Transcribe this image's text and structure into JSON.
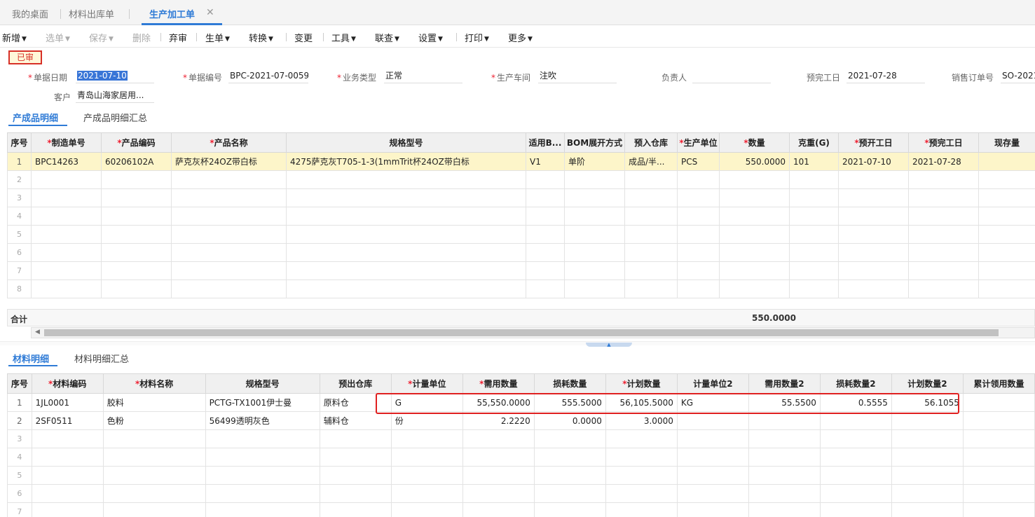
{
  "tabs": [
    {
      "label": "我的桌面"
    },
    {
      "label": "材料出库单"
    },
    {
      "label": "生产加工单"
    }
  ],
  "toolbar": {
    "add": "新增",
    "select": "选单",
    "save": "保存",
    "delete": "删除",
    "unaudit": "弃审",
    "generate": "生单",
    "convert": "转换",
    "change": "变更",
    "tools": "工具",
    "link": "联查",
    "settings": "设置",
    "print": "打印",
    "more": "更多"
  },
  "status": "已审",
  "form": {
    "doc_date": {
      "label": "单据日期",
      "value": "2021-07-10"
    },
    "doc_no": {
      "label": "单据编号",
      "value": "BPC-2021-07-0059"
    },
    "biz_type": {
      "label": "业务类型",
      "value": "正常"
    },
    "workshop": {
      "label": "生产车间",
      "value": "注吹"
    },
    "owner": {
      "label": "负责人",
      "value": ""
    },
    "finish_date": {
      "label": "预完工日",
      "value": "2021-07-28"
    },
    "sales_order": {
      "label": "销售订单号",
      "value": "SO-2021"
    },
    "customer": {
      "label": "客户",
      "value": "青岛山海家居用..."
    }
  },
  "product_tabs": {
    "detail": "产成品明细",
    "summary": "产成品明细汇总"
  },
  "product_grid": {
    "headers": [
      "序号",
      "制造单号",
      "产品编码",
      "产品名称",
      "规格型号",
      "适用B...",
      "BOM展开方式",
      "预入仓库",
      "生产单位",
      "数量",
      "克重(G)",
      "预开工日",
      "预完工日",
      "现存量"
    ],
    "rows": [
      [
        "1",
        "BPC14263",
        "60206102A",
        "萨克灰杯24OZ带白标",
        "4275萨克灰T705-1-3(1mmTrit杯24OZ带白标",
        "V1",
        "单阶",
        "成品/半...",
        "PCS",
        "550.0000",
        "101",
        "2021-07-10",
        "2021-07-28",
        ""
      ]
    ],
    "empty_rows": [
      "2",
      "3",
      "4",
      "5",
      "6",
      "7",
      "8"
    ],
    "total_label": "合计",
    "total_qty": "550.0000"
  },
  "material_tabs": {
    "detail": "材料明细",
    "summary": "材料明细汇总"
  },
  "material_grid": {
    "headers": [
      "序号",
      "材料编码",
      "材料名称",
      "规格型号",
      "预出仓库",
      "计量单位",
      "需用数量",
      "损耗数量",
      "计划数量",
      "计量单位2",
      "需用数量2",
      "损耗数量2",
      "计划数量2",
      "累计领用数量"
    ],
    "rows": [
      [
        "1",
        "1JL0001",
        "胶料",
        "PCTG-TX1001伊士曼",
        "原料仓",
        "G",
        "55,550.0000",
        "555.5000",
        "56,105.5000",
        "KG",
        "55.5500",
        "0.5555",
        "56.1055",
        ""
      ],
      [
        "2",
        "2SF0511",
        "色粉",
        "56499透明灰色",
        "辅料仓",
        "份",
        "2.2220",
        "0.0000",
        "3.0000",
        "",
        "",
        "",
        "",
        ""
      ]
    ],
    "empty_rows": [
      "3",
      "4",
      "5",
      "6",
      "7"
    ]
  }
}
